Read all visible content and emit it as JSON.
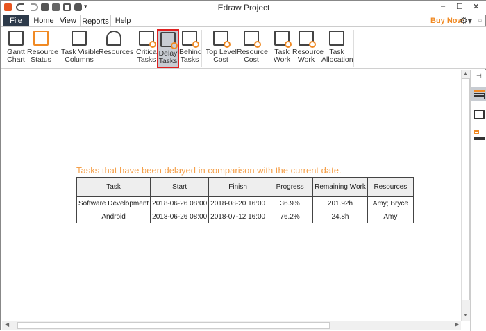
{
  "window": {
    "title": "Edraw Project",
    "buy_now": "Buy Now",
    "minimize": "–",
    "maximize": "☐",
    "close": "✕"
  },
  "tabs": [
    "File",
    "Home",
    "View",
    "Reports",
    "Help"
  ],
  "ribbon": [
    {
      "label": "Gantt\nChart"
    },
    {
      "label": "Resource\nStatus"
    },
    {
      "label": "Task Visible\nColumns"
    },
    {
      "label": "Resources"
    },
    {
      "label": "Critical\nTasks"
    },
    {
      "label": "Delay\nTasks"
    },
    {
      "label": "Behind\nTasks"
    },
    {
      "label": "Top Level\nCost"
    },
    {
      "label": "Resource\nCost"
    },
    {
      "label": "Task\nWork"
    },
    {
      "label": "Resource\nWork"
    },
    {
      "label": "Task\nAllocation"
    }
  ],
  "report": {
    "caption": "Tasks that have been delayed in comparison with the current date.",
    "columns": [
      "Task",
      "Start",
      "Finish",
      "Progress",
      "Remaining Work",
      "Resources"
    ],
    "rows": [
      [
        "Software Development",
        "2018-06-26 08:00",
        "2018-08-20 16:00",
        "36.9%",
        "201.92h",
        "Amy; Bryce"
      ],
      [
        "Android",
        "2018-06-26 08:00",
        "2018-07-12 16:00",
        "76.2%",
        "24.8h",
        "Amy"
      ]
    ]
  },
  "colors": {
    "accent": "#f08a24",
    "caption": "#f5a04a",
    "file_tab": "#2d3a4a",
    "selected_border": "#e02020"
  }
}
